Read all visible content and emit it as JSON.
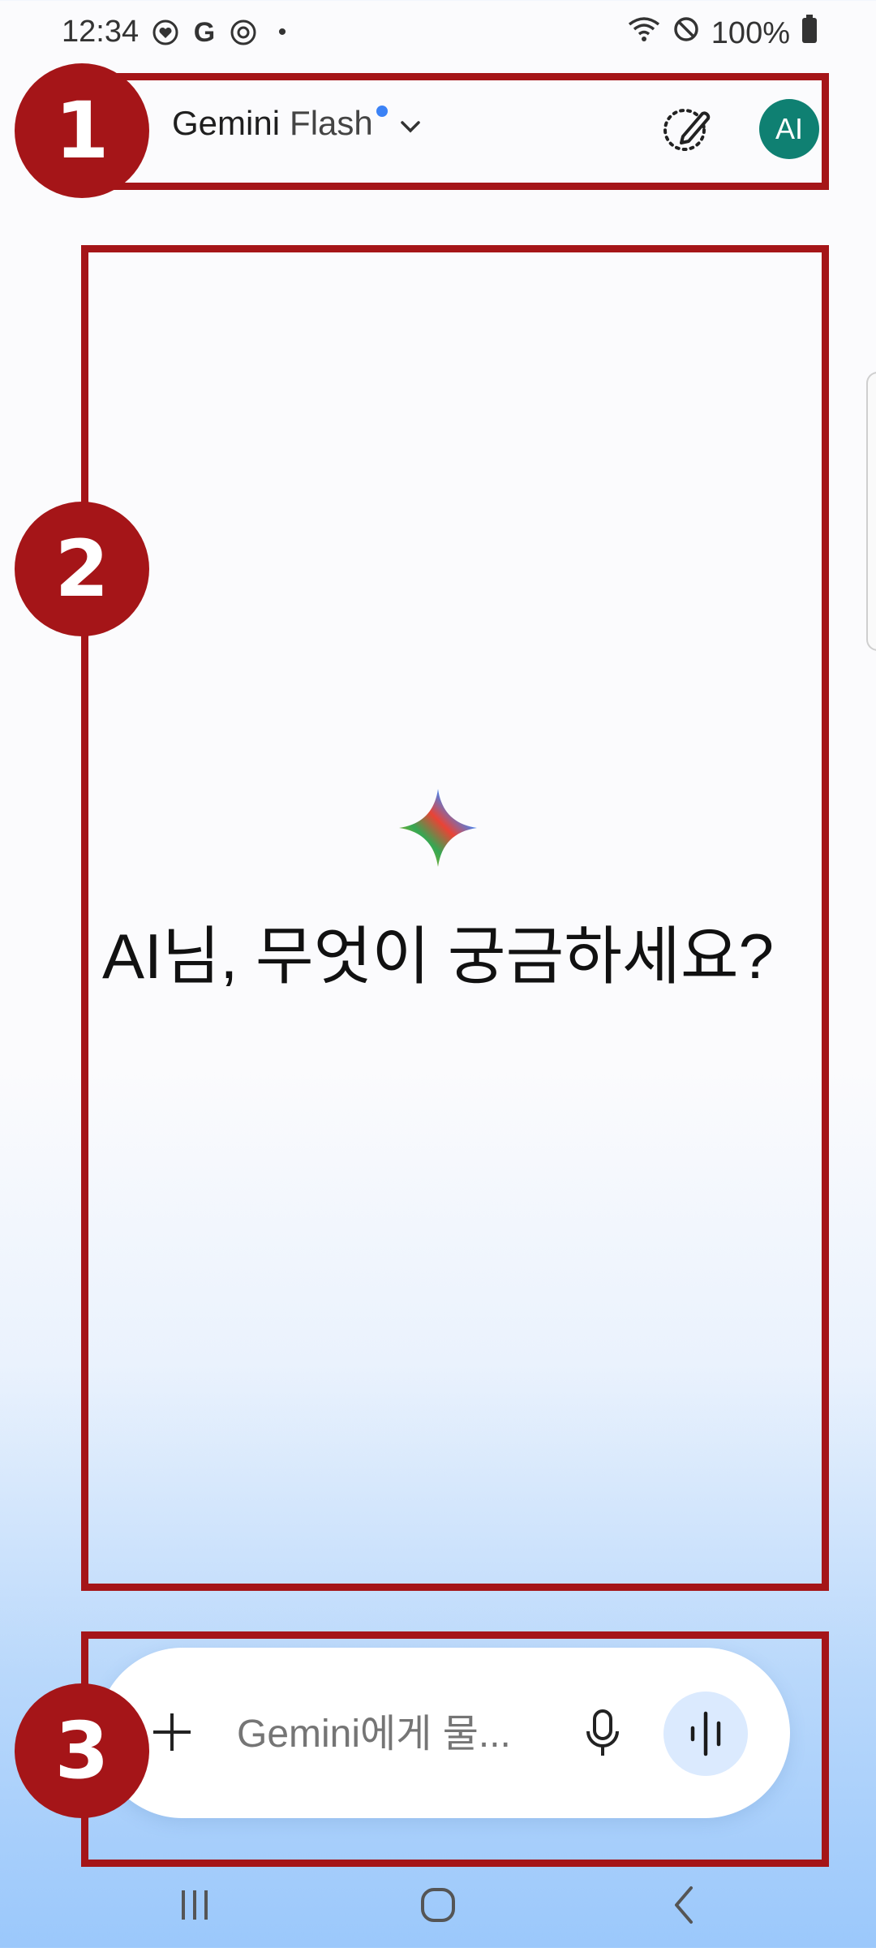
{
  "status_bar": {
    "time": "12:34",
    "battery": "100%",
    "dot": "•",
    "g_letter": "G"
  },
  "header": {
    "app_name": "Gemini",
    "model": "Flash",
    "avatar_initials": "AI"
  },
  "main": {
    "greeting": "AI님, 무엇이 궁금하세요?"
  },
  "composer": {
    "placeholder": "Gemini에게 물..."
  },
  "annotations": {
    "labels": [
      "1",
      "2",
      "3"
    ]
  },
  "colors": {
    "annotation": "#a51518",
    "avatar": "#0f8072",
    "accent_dot": "#3b82f6",
    "live_button": "#dbeafe"
  },
  "icons": {
    "status": [
      "heart-icon",
      "google-icon",
      "sync-icon",
      "wifi-icon",
      "do-not-disturb-icon",
      "battery-icon"
    ],
    "header": [
      "chevron-down-icon",
      "new-chat-pencil-icon"
    ],
    "composer": [
      "plus-icon",
      "microphone-icon",
      "live-audio-icon"
    ],
    "nav": [
      "recent-apps-icon",
      "home-icon",
      "back-icon"
    ]
  }
}
